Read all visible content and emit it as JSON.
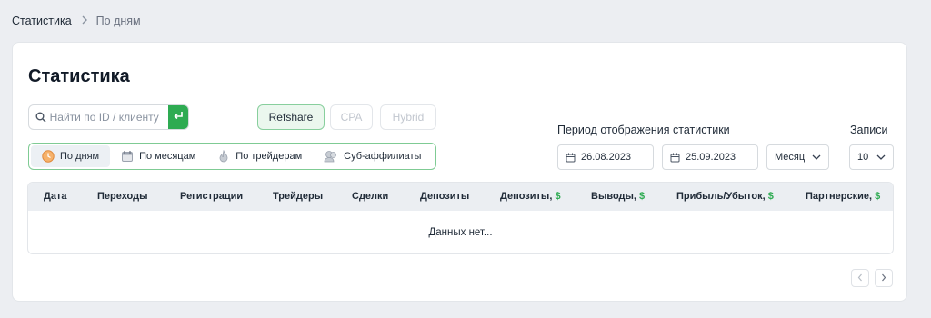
{
  "breadcrumb": {
    "root": "Статистика",
    "current": "По дням"
  },
  "page": {
    "title": "Статистика"
  },
  "search": {
    "placeholder": "Найти по ID / клиенту",
    "value": ""
  },
  "models": [
    {
      "label": "Refshare",
      "active": true
    },
    {
      "label": "CPA",
      "active": false
    },
    {
      "label": "Hybrid",
      "active": false
    }
  ],
  "tabs": [
    {
      "label": "По дням",
      "icon": "clock-icon",
      "active": true
    },
    {
      "label": "По месяцам",
      "icon": "calendar-icon",
      "active": false
    },
    {
      "label": "По трейдерам",
      "icon": "flame-icon",
      "active": false
    },
    {
      "label": "Суб-аффилиаты",
      "icon": "users-icon",
      "active": false
    }
  ],
  "filters": {
    "period_label": "Период отображения статистики",
    "date_from": "26.08.2023",
    "date_to": "25.09.2023",
    "period_select": "Месяц",
    "records_label": "Записи",
    "records_select": "10"
  },
  "table": {
    "columns": [
      {
        "label": "Дата",
        "currency": ""
      },
      {
        "label": "Переходы",
        "currency": ""
      },
      {
        "label": "Регистрации",
        "currency": ""
      },
      {
        "label": "Трейдеры",
        "currency": ""
      },
      {
        "label": "Сделки",
        "currency": ""
      },
      {
        "label": "Депозиты",
        "currency": ""
      },
      {
        "label": "Депозиты, ",
        "currency": "$"
      },
      {
        "label": "Выводы, ",
        "currency": "$"
      },
      {
        "label": "Прибыль/Убыток, ",
        "currency": "$"
      },
      {
        "label": "Партнерские, ",
        "currency": "$"
      }
    ],
    "empty_text": "Данных нет..."
  },
  "colors": {
    "accent": "#2eab52",
    "header_bg": "#ebeef2",
    "page_bg": "#eceef2"
  }
}
